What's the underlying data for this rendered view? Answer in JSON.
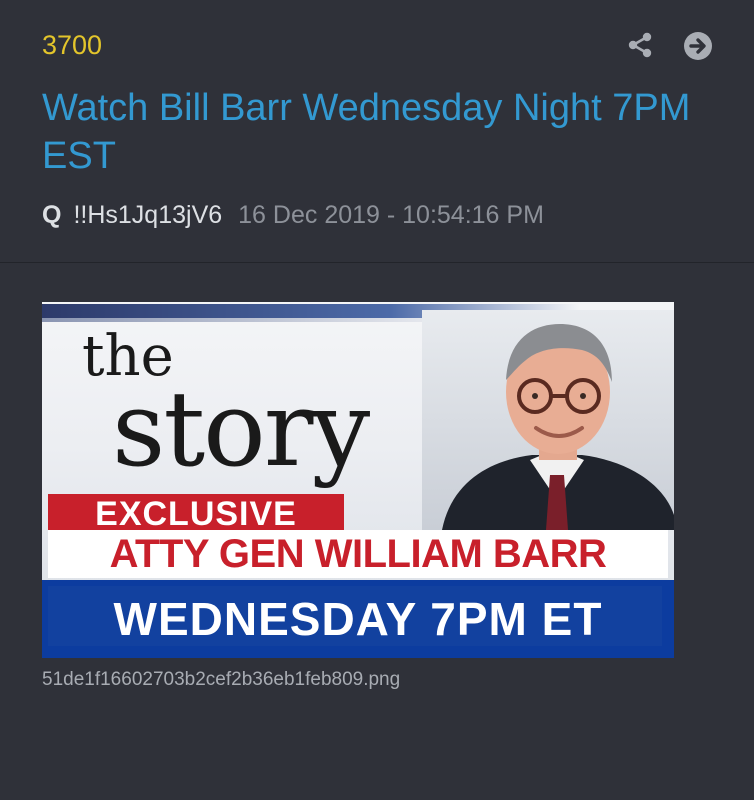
{
  "post": {
    "number": "3700",
    "title": "Watch Bill Barr Wednesday Night 7PM EST",
    "author": "Q",
    "tripcode": "!!Hs1Jq13jV6",
    "timestamp": "16 Dec 2019 - 10:54:16 PM"
  },
  "icons": {
    "share": "share-icon",
    "go": "arrow-right-circle-icon"
  },
  "attachment": {
    "logo_top": "the",
    "logo_main": "story",
    "banner_exclusive": "EXCLUSIVE",
    "banner_name": "ATTY GEN WILLIAM BARR",
    "banner_time": "WEDNESDAY 7PM ET",
    "filename": "51de1f16602703b2cef2b36eb1feb809.png"
  },
  "colors": {
    "background": "#2f3139",
    "post_number": "#e3c52b",
    "title": "#3399d1",
    "meta_text": "#dde0e4",
    "timestamp": "#8d9199",
    "banner_red": "#c8202b",
    "banner_blue": "#0c3c9f"
  }
}
